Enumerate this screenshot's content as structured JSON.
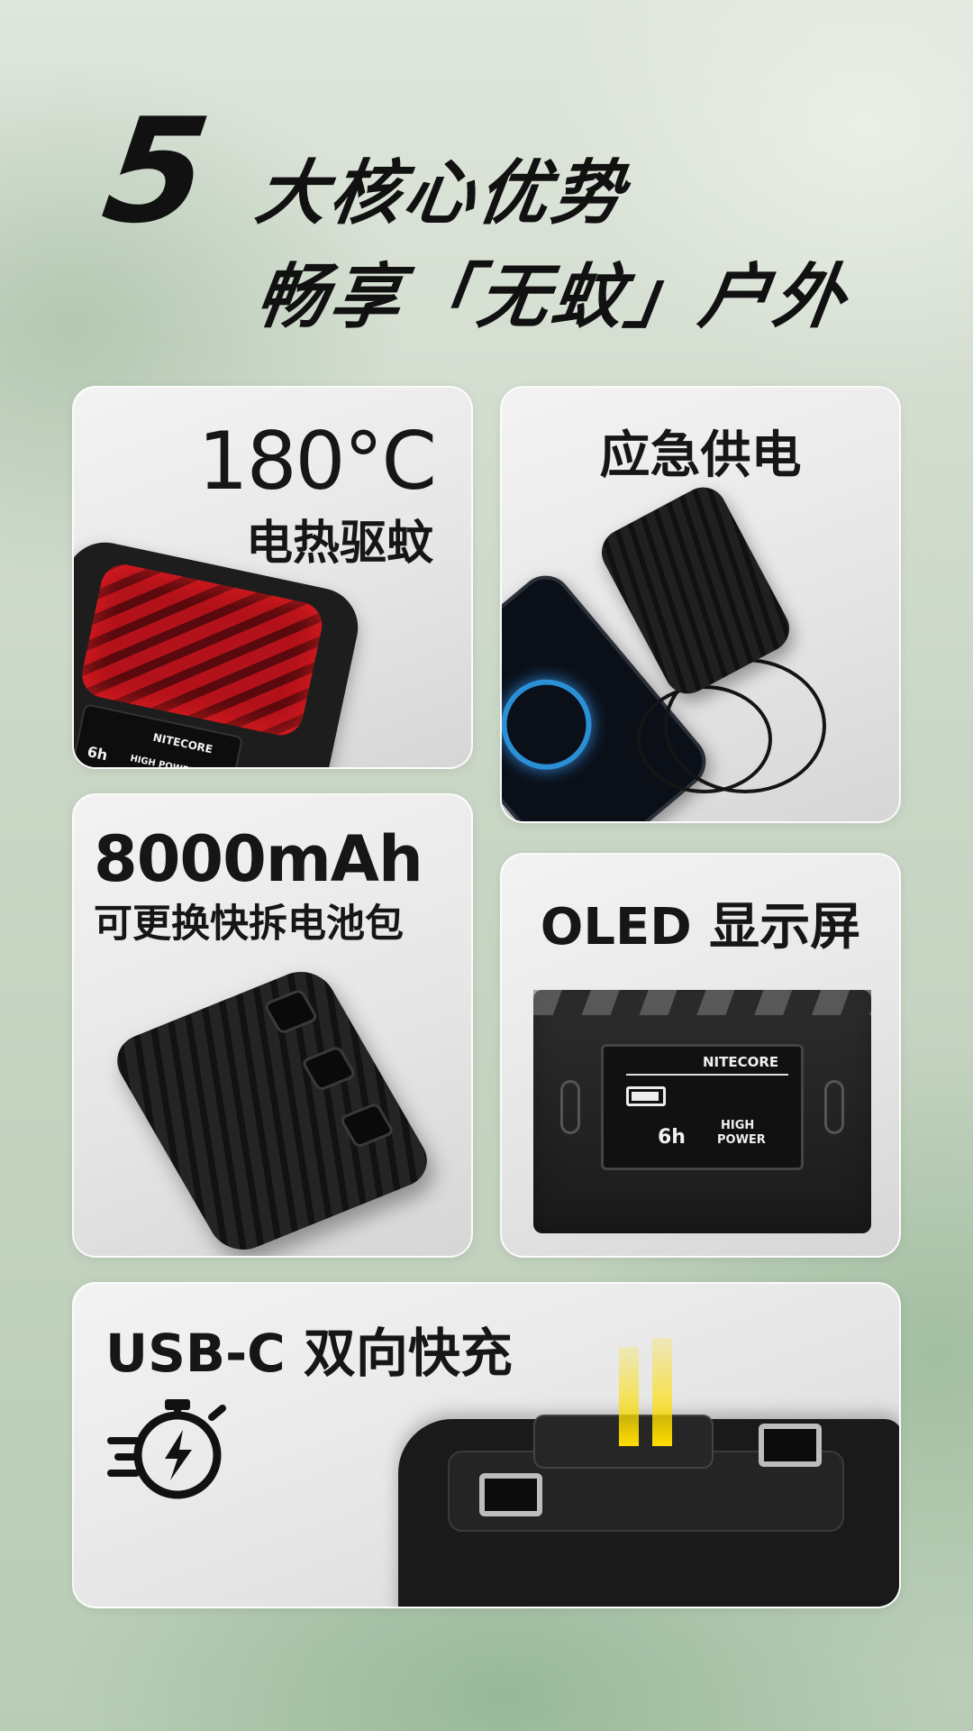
{
  "headline": {
    "number": "5",
    "line1": "大核心优势",
    "line2": "畅享「无蚊」户外"
  },
  "cards": {
    "heating": {
      "title": "180°C",
      "subtitle": "电热驱蚊",
      "oled_brand": "NITECORE",
      "oled_hours": "6h",
      "oled_mode": "HIGH POWER"
    },
    "power": {
      "title": "应急供电"
    },
    "battery": {
      "title": "8000mAh",
      "subtitle": "可更换快拆电池包"
    },
    "oled": {
      "title": "OLED 显示屏",
      "brand": "NITECORE",
      "hours": "6h",
      "mode_line1": "HIGH",
      "mode_line2": "POWER"
    },
    "usb": {
      "title": "USB-C 双向快充"
    }
  },
  "icons": [
    "stopwatch-bolt-icon"
  ],
  "colors": {
    "accent_red": "#b3121a",
    "accent_yellow": "#ffde00",
    "text": "#111111"
  }
}
